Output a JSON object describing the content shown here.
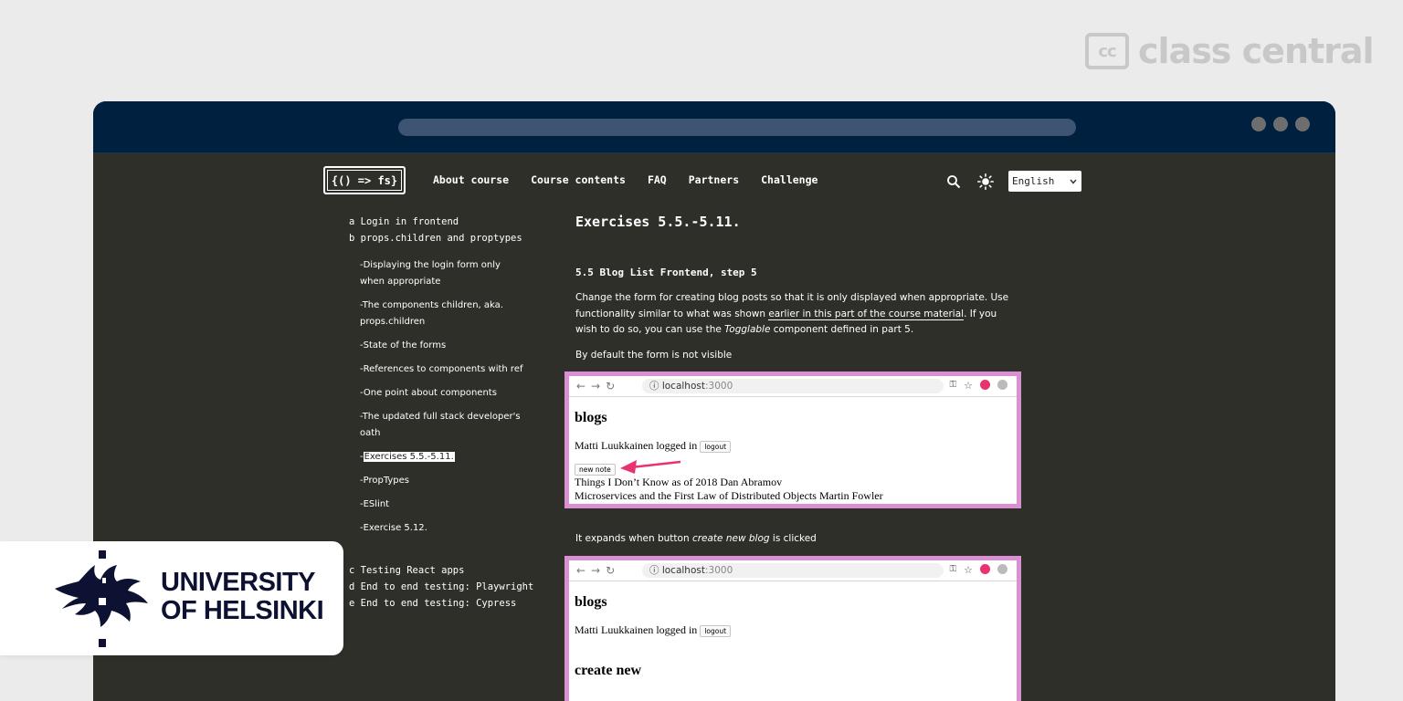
{
  "brand": {
    "logo_glyph": "cc",
    "name": "class central"
  },
  "site": {
    "logo_text": "{() => fs}",
    "nav": [
      "About course",
      "Course contents",
      "FAQ",
      "Partners",
      "Challenge"
    ],
    "language": "English"
  },
  "sidebar": {
    "parts": [
      {
        "letter": "a",
        "label": "Login in frontend"
      },
      {
        "letter": "b",
        "label": "props.children and proptypes"
      }
    ],
    "subsections": [
      "-Displaying the login form only when appropriate",
      "-The components children, aka. props.children",
      "-State of the forms",
      "-References to components with ref",
      "-One point about components",
      "-The updated full stack developer's oath",
      "-Exercises 5.5.-5.11.",
      "-PropTypes",
      "-ESlint",
      "-Exercise 5.12."
    ],
    "active_prefix": "-",
    "active_label": "Exercises 5.5.-5.11.",
    "more_parts": [
      {
        "letter": "c",
        "label": "Testing React apps"
      },
      {
        "letter": "d",
        "label": "End to end testing: Playwright"
      },
      {
        "letter": "e",
        "label": "End to end testing: Cypress"
      }
    ]
  },
  "content": {
    "title": "Exercises 5.5.-5.11.",
    "exercise_heading": "5.5 Blog List Frontend, step 5",
    "para1_a": "Change the form for creating blog posts so that it is only displayed when appropriate. Use functionality similar to what was shown ",
    "para1_link": "earlier in this part of the course material",
    "para1_b": ". If you wish to do so, you can use the ",
    "para1_em": "Togglable",
    "para1_c": " component defined in part 5.",
    "para2": "By default the form is not visible",
    "para3_a": "It expands when button ",
    "para3_em": "create new blog",
    "para3_b": " is clicked"
  },
  "screenshot1": {
    "url_host": "localhost",
    "url_port": ":3000",
    "heading": "blogs",
    "logged_in": "Matti Luukkainen logged in",
    "logout": "logout",
    "new_note": "new note",
    "blog1": "Things I Don’t Know as of 2018 Dan Abramov",
    "blog2": "Microservices and the First Law of Distributed Objects Martin Fowler"
  },
  "screenshot2": {
    "url_host": "localhost",
    "url_port": ":3000",
    "heading": "blogs",
    "logged_in": "Matti Luukkainen logged in",
    "logout": "logout",
    "create_heading": "create new"
  },
  "university": {
    "line1": "UNIVERSITY",
    "line2": "OF HELSINKI"
  },
  "colors": {
    "browser_bar": "#00203f",
    "page_bg": "#2f2f2a",
    "screenshot_border": "#d98fd1",
    "arrow": "#e8336d",
    "uh_navy": "#0d1233"
  }
}
